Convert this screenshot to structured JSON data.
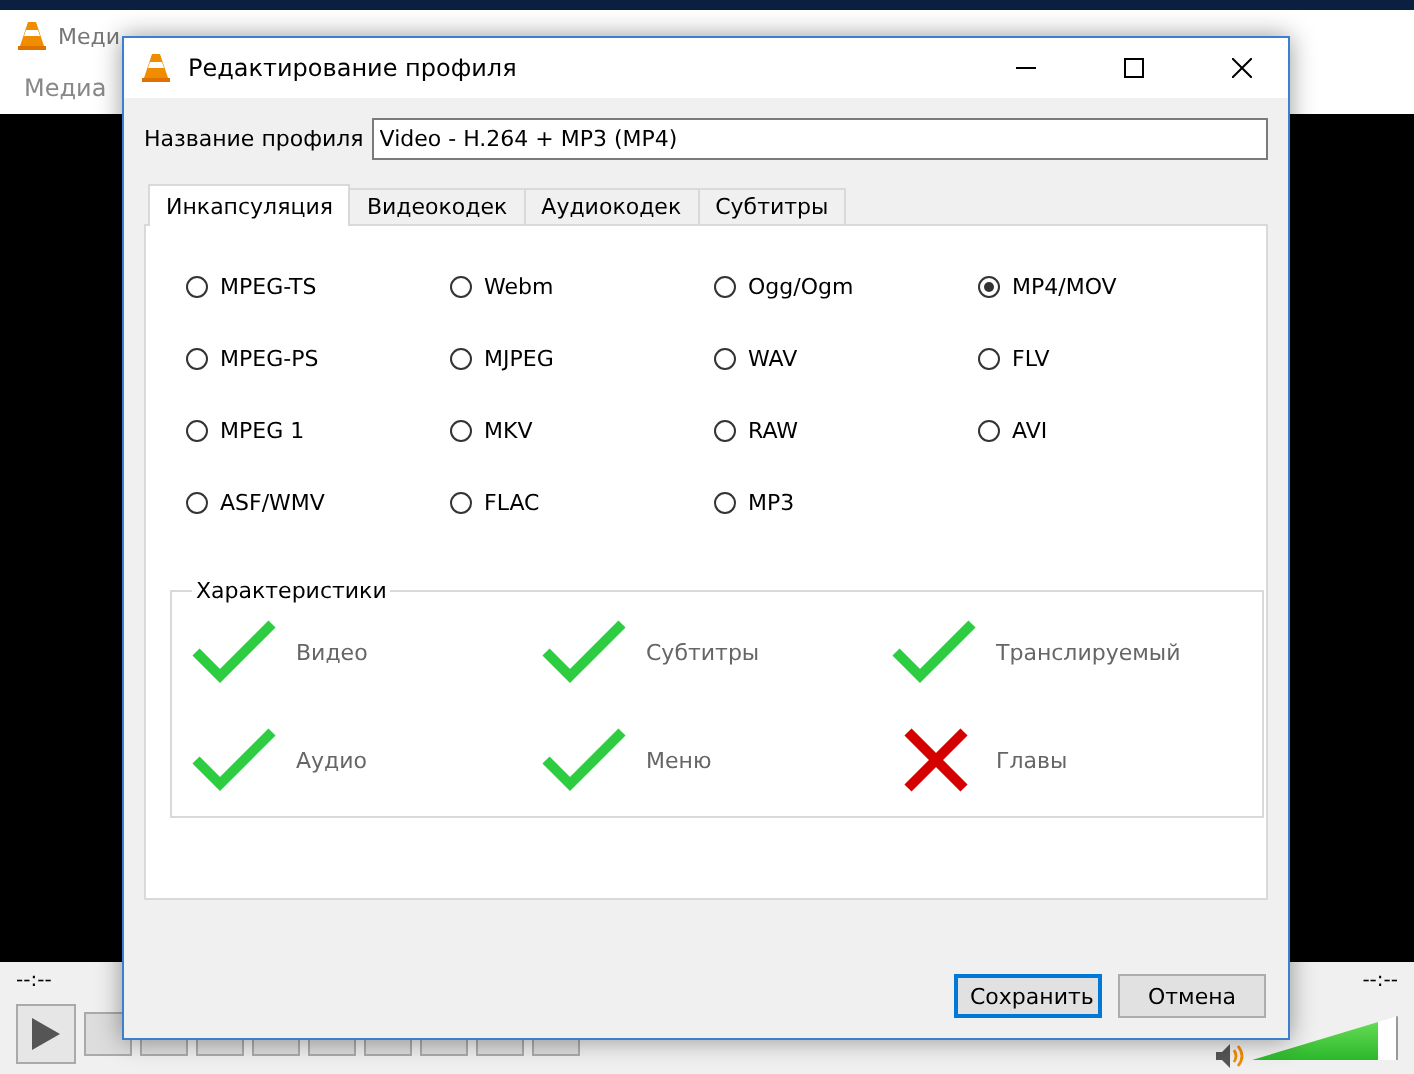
{
  "main_window": {
    "title": "Меди",
    "menu": [
      "Медиа"
    ],
    "time_elapsed": "--:--",
    "time_total": "--:--",
    "volume": {
      "level": 0.88
    }
  },
  "dialog": {
    "title": "Редактирование профиля",
    "profile_label": "Название профиля",
    "profile_name": "Video - H.264 + MP3 (MP4)",
    "tabs": [
      {
        "label": "Инкапсуляция",
        "selected": true
      },
      {
        "label": "Видеокодек",
        "selected": false
      },
      {
        "label": "Аудиокодек",
        "selected": false
      },
      {
        "label": "Субтитры",
        "selected": false
      }
    ],
    "formats": [
      {
        "label": "MPEG-TS",
        "selected": false
      },
      {
        "label": "Webm",
        "selected": false
      },
      {
        "label": "Ogg/Ogm",
        "selected": false
      },
      {
        "label": "MP4/MOV",
        "selected": true
      },
      {
        "label": "MPEG-PS",
        "selected": false
      },
      {
        "label": "MJPEG",
        "selected": false
      },
      {
        "label": "WAV",
        "selected": false
      },
      {
        "label": "FLV",
        "selected": false
      },
      {
        "label": "MPEG 1",
        "selected": false
      },
      {
        "label": "MKV",
        "selected": false
      },
      {
        "label": "RAW",
        "selected": false
      },
      {
        "label": "AVI",
        "selected": false
      },
      {
        "label": "ASF/WMV",
        "selected": false
      },
      {
        "label": "FLAC",
        "selected": false
      },
      {
        "label": "MP3",
        "selected": false
      }
    ],
    "features_title": "Характеристики",
    "features": [
      {
        "label": "Видео",
        "supported": true
      },
      {
        "label": "Субтитры",
        "supported": true
      },
      {
        "label": "Транслируемый",
        "supported": true
      },
      {
        "label": "Аудио",
        "supported": true
      },
      {
        "label": "Меню",
        "supported": true
      },
      {
        "label": "Главы",
        "supported": false
      }
    ],
    "buttons": [
      {
        "label": "Сохранить",
        "default": true
      },
      {
        "label": "Отмена",
        "default": false
      }
    ]
  }
}
